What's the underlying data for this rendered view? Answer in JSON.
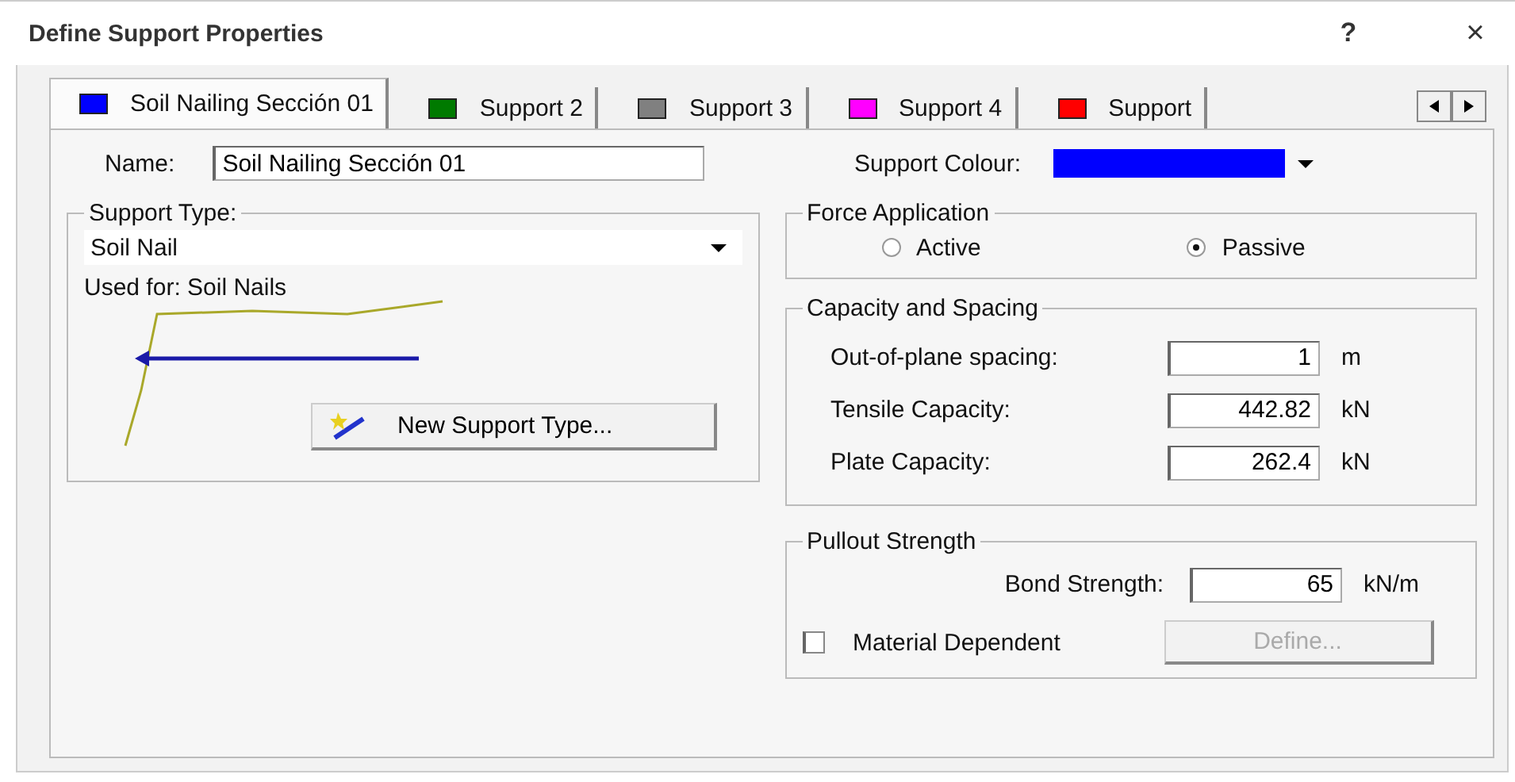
{
  "window": {
    "title": "Define Support Properties",
    "help": "?",
    "close": "×"
  },
  "tabs": [
    {
      "label": "Soil Nailing Sección 01",
      "color": "#0000ff",
      "selected": true
    },
    {
      "label": "Support 2",
      "color": "#007a00",
      "selected": false
    },
    {
      "label": "Support 3",
      "color": "#808080",
      "selected": false
    },
    {
      "label": "Support 4",
      "color": "#ff00ff",
      "selected": false
    },
    {
      "label": "Support",
      "color": "#ff0000",
      "selected": false
    }
  ],
  "name_field": {
    "label": "Name:",
    "value": "Soil Nailing Sección 01"
  },
  "support_colour": {
    "label": "Support Colour:",
    "color": "#0000ff"
  },
  "support_type": {
    "title": "Support Type:",
    "value": "Soil Nail",
    "used_for": "Used for: Soil Nails",
    "button": "New Support Type..."
  },
  "force_application": {
    "title": "Force Application",
    "options": [
      {
        "label": "Active",
        "selected": false
      },
      {
        "label": "Passive",
        "selected": true
      }
    ]
  },
  "capacity_and_spacing": {
    "title": "Capacity and Spacing",
    "rows": [
      {
        "label": "Out-of-plane spacing:",
        "value": "1",
        "unit": "m"
      },
      {
        "label": "Tensile Capacity:",
        "value": "442.82",
        "unit": "kN"
      },
      {
        "label": "Plate Capacity:",
        "value": "262.4",
        "unit": "kN"
      }
    ]
  },
  "pullout_strength": {
    "title": "Pullout Strength",
    "rows": [
      {
        "label": "Bond Strength:",
        "value": "65",
        "unit": "kN/m"
      }
    ],
    "material_dependent": {
      "label": "Material Dependent",
      "checked": false
    },
    "define_button": {
      "label": "Define...",
      "disabled": true
    }
  }
}
